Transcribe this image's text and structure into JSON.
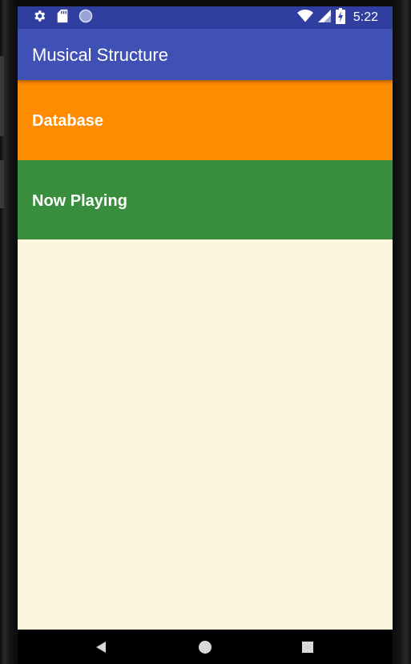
{
  "app": {
    "title": "Musical Structure"
  },
  "status_bar": {
    "time": "5:22",
    "icons_left": [
      "settings-icon",
      "sd-card-icon",
      "sync-circle-icon"
    ],
    "icons_right": [
      "wifi-icon",
      "signal-icon",
      "battery-charging-icon"
    ]
  },
  "menu": {
    "items": [
      {
        "label": "Database",
        "color": "#ff8c00"
      },
      {
        "label": "Now Playing",
        "color": "#388e3c"
      }
    ]
  },
  "nav_bar": {
    "buttons": [
      "back-icon",
      "home-icon",
      "recents-icon"
    ]
  },
  "colors": {
    "primary": "#3f51b5",
    "primary_dark": "#303f9f",
    "background": "#fdf6dc"
  }
}
